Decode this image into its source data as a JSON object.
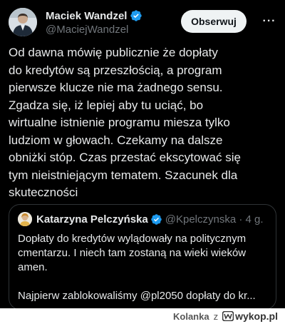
{
  "author": {
    "name": "Maciek Wandzel",
    "handle": "@MaciejWandzel",
    "avatar_icon": "profile-photo",
    "verified_icon": "verified-badge-icon",
    "verified_color": "#1d9bf0"
  },
  "actions": {
    "follow_label": "Obserwuj",
    "more_label": "···"
  },
  "tweet": {
    "text": "Od dawna mówię publicznie że dopłaty\ndo kredytów są przeszłością, a program\npierwsze klucze nie ma żadnego sensu.\nZgadza się, iż lepiej aby tu uciąć, bo\nwirtualne istnienie programu miesza tylko\nludziom w głowach. Czekamy na dalsze\nobniżki stóp. Czas przestać ekscytować się\ntym nieistniejącym tematem. Szacunek dla\nskuteczności"
  },
  "quoted": {
    "name": "Katarzyna Pelczyńska",
    "handle_time": "@Kpelczynska · 4 g.",
    "text": "Dopłaty do kredytów wylądowały na politycznym\ncmentarzu. I niech tam zostaną na wieki wieków\namen.\n\nNajpierw zablokowaliśmy @pl2050 dopłaty do kr..."
  },
  "footer": {
    "user": "Kolanka",
    "separator": "z",
    "site": "wykop.pl"
  },
  "colors": {
    "background": "#000000",
    "text": "#e7e9ea",
    "muted": "#71767b",
    "border": "#2f3336",
    "follow_bg": "#eff3f4"
  }
}
